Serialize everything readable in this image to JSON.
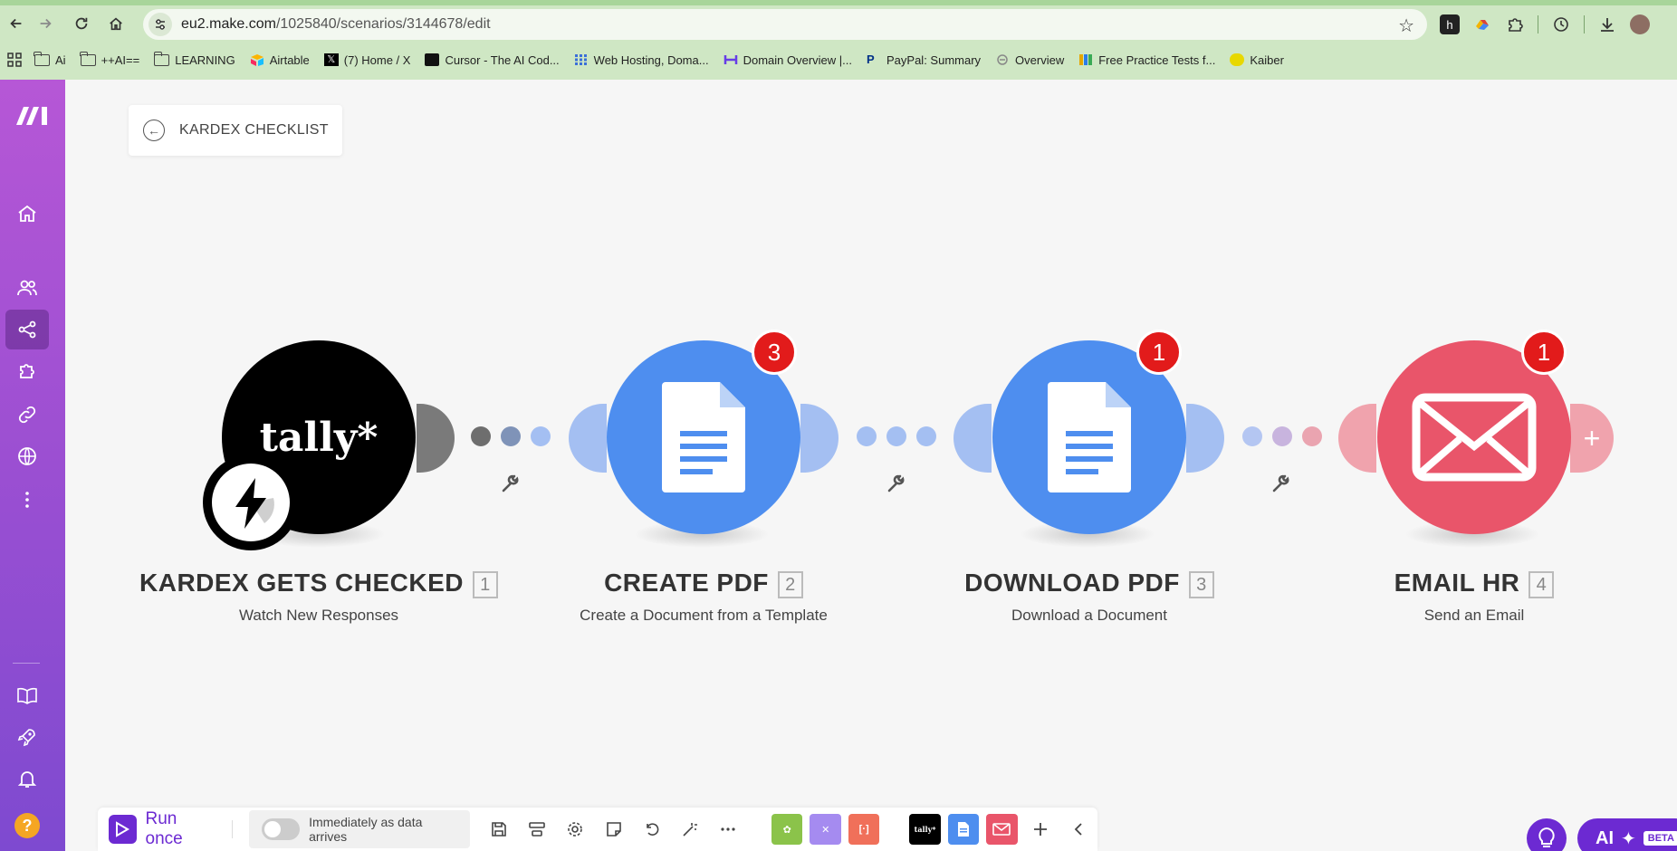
{
  "browser": {
    "url_host": "eu2.make.com",
    "url_path": "/1025840/scenarios/3144678/edit",
    "bookmarks": [
      {
        "label": "Ai",
        "icon": "folder-icon"
      },
      {
        "label": "++AI==",
        "icon": "folder-icon"
      },
      {
        "label": "LEARNING",
        "icon": "folder-icon"
      },
      {
        "label": "Airtable",
        "icon": "airtable-icon"
      },
      {
        "label": "(7) Home / X",
        "icon": "x-icon"
      },
      {
        "label": "Cursor - The AI Cod...",
        "icon": "cursor-icon"
      },
      {
        "label": "Web Hosting, Doma...",
        "icon": "grid-icon"
      },
      {
        "label": "Domain Overview |...",
        "icon": "semrush-icon"
      },
      {
        "label": "PayPal: Summary",
        "icon": "paypal-icon"
      },
      {
        "label": "Overview",
        "icon": "overview-icon"
      },
      {
        "label": "Free Practice Tests f...",
        "icon": "books-icon"
      },
      {
        "label": "Kaiber",
        "icon": "kaiber-icon"
      }
    ]
  },
  "scenario": {
    "title": "KARDEX CHECKLIST"
  },
  "modules": [
    {
      "title": "KARDEX GETS CHECKED",
      "number": "1",
      "subtitle": "Watch New Responses",
      "app": "tally*",
      "color": "#000000",
      "badge": ""
    },
    {
      "title": "CREATE PDF",
      "number": "2",
      "subtitle": "Create a Document from a Template",
      "app": "google-docs",
      "color": "#4e8eef",
      "badge": "3"
    },
    {
      "title": "DOWNLOAD PDF",
      "number": "3",
      "subtitle": "Download a Document",
      "app": "google-docs",
      "color": "#4e8eef",
      "badge": "1"
    },
    {
      "title": "EMAIL HR",
      "number": "4",
      "subtitle": "Send an Email",
      "app": "email",
      "color": "#e9556a",
      "badge": "1"
    }
  ],
  "toolbar": {
    "run_label": "Run once",
    "schedule_label": "Immediately as data arrives",
    "tools": [
      "save-icon",
      "autoalign-icon",
      "settings-icon",
      "notes-icon",
      "undo-icon",
      "magic-icon",
      "more-icon"
    ],
    "apps": [
      {
        "name": "tools-icon",
        "color": "#8bc34a"
      },
      {
        "name": "flow-control-icon",
        "color": "#a58bf0"
      },
      {
        "name": "text-parser-icon",
        "color": "#f0705a"
      },
      {
        "name": "tally-icon",
        "color": "#000000"
      },
      {
        "name": "google-docs-icon",
        "color": "#4e8eef"
      },
      {
        "name": "email-icon",
        "color": "#e9556a"
      }
    ]
  },
  "ai_button": {
    "label": "AI",
    "badge": "BETA"
  }
}
